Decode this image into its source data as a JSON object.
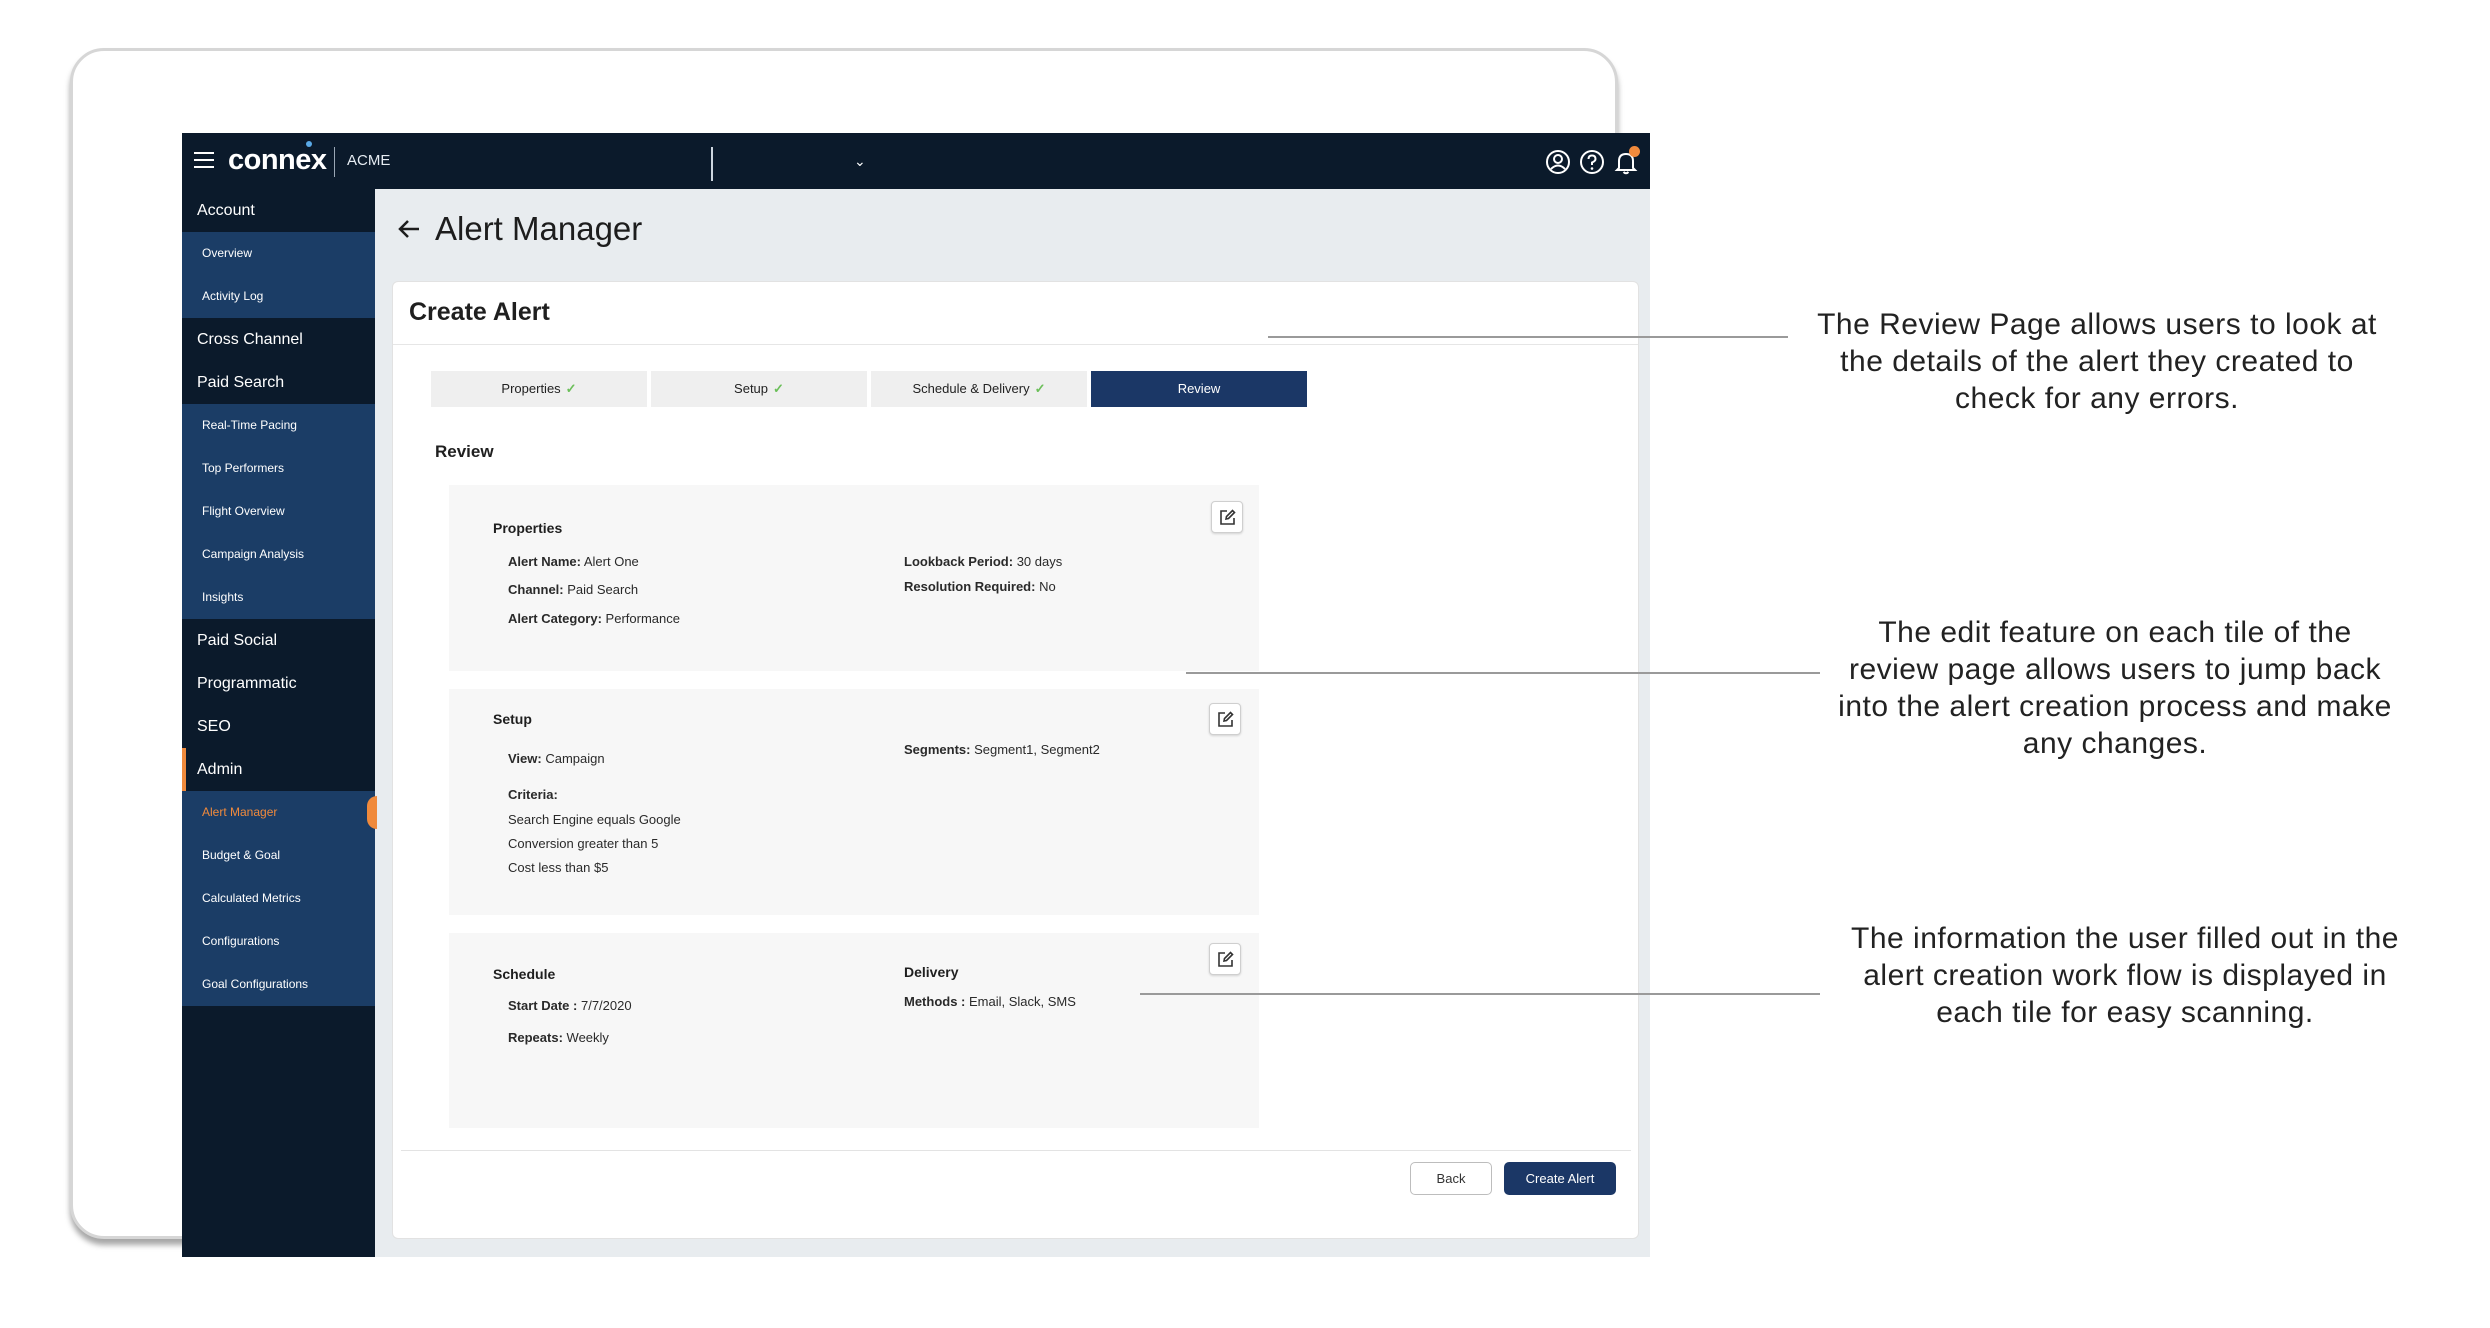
{
  "app": {
    "logo": "connex",
    "account": "ACME"
  },
  "sidebar": {
    "sections": [
      {
        "label": "Account",
        "items": [
          "Overview",
          "Activity Log"
        ]
      },
      {
        "label": "Cross Channel",
        "items": []
      },
      {
        "label": "Paid Search",
        "items": [
          "Real-Time Pacing",
          "Top Performers",
          "Flight Overview",
          "Campaign Analysis",
          "Insights"
        ]
      },
      {
        "label": "Paid Social",
        "items": []
      },
      {
        "label": "Programmatic",
        "items": []
      },
      {
        "label": "SEO",
        "items": []
      },
      {
        "label": "Admin",
        "items": [
          "Alert Manager",
          "Budget & Goal",
          "Calculated Metrics",
          "Configurations",
          "Goal Configurations"
        ]
      }
    ],
    "active_item": "Alert Manager"
  },
  "page": {
    "title": "Alert Manager",
    "card_title": "Create Alert",
    "steps": [
      {
        "label": "Properties",
        "done": true
      },
      {
        "label": "Setup",
        "done": true
      },
      {
        "label": "Schedule & Delivery",
        "done": true
      },
      {
        "label": "Review",
        "done": false,
        "active": true
      }
    ],
    "review_label": "Review"
  },
  "properties": {
    "title": "Properties",
    "alert_name_key": "Alert Name:",
    "alert_name_val": "Alert One",
    "channel_key": "Channel:",
    "channel_val": "Paid Search",
    "category_key": "Alert Category:",
    "category_val": "Performance",
    "lookback_key": "Lookback Period:",
    "lookback_val": "30 days",
    "resolution_key": "Resolution Required:",
    "resolution_val": "No"
  },
  "setup": {
    "title": "Setup",
    "view_key": "View:",
    "view_val": "Campaign",
    "criteria_key": "Criteria:",
    "criteria": [
      "Search Engine equals Google",
      "Conversion greater than 5",
      "Cost less than $5"
    ],
    "segments_key": "Segments:",
    "segments_val": "Segment1, Segment2"
  },
  "schedule": {
    "title": "Schedule",
    "start_key": "Start Date :",
    "start_val": "7/7/2020",
    "repeats_key": "Repeats:",
    "repeats_val": "Weekly",
    "delivery_title": "Delivery",
    "methods_key": "Methods :",
    "methods_val": "Email, Slack, SMS"
  },
  "actions": {
    "back": "Back",
    "create": "Create Alert"
  },
  "annotations": [
    "The Review Page allows users to look at the details of the alert they created to check for any errors.",
    "The edit feature on each tile of the review page allows users to jump back into the alert creation process and make any changes.",
    "The information the user filled out in the alert creation work flow is displayed in each tile for easy scanning."
  ],
  "colors": {
    "nav_dark": "#0b1a2b",
    "nav_sub": "#1b3d66",
    "accent_orange": "#f08a3c",
    "primary_button": "#1b3766",
    "check_green": "#6bbf59"
  },
  "icons": [
    "hamburger-icon",
    "user-icon",
    "help-icon",
    "bell-icon",
    "back-arrow-icon",
    "edit-icon",
    "check-icon"
  ]
}
